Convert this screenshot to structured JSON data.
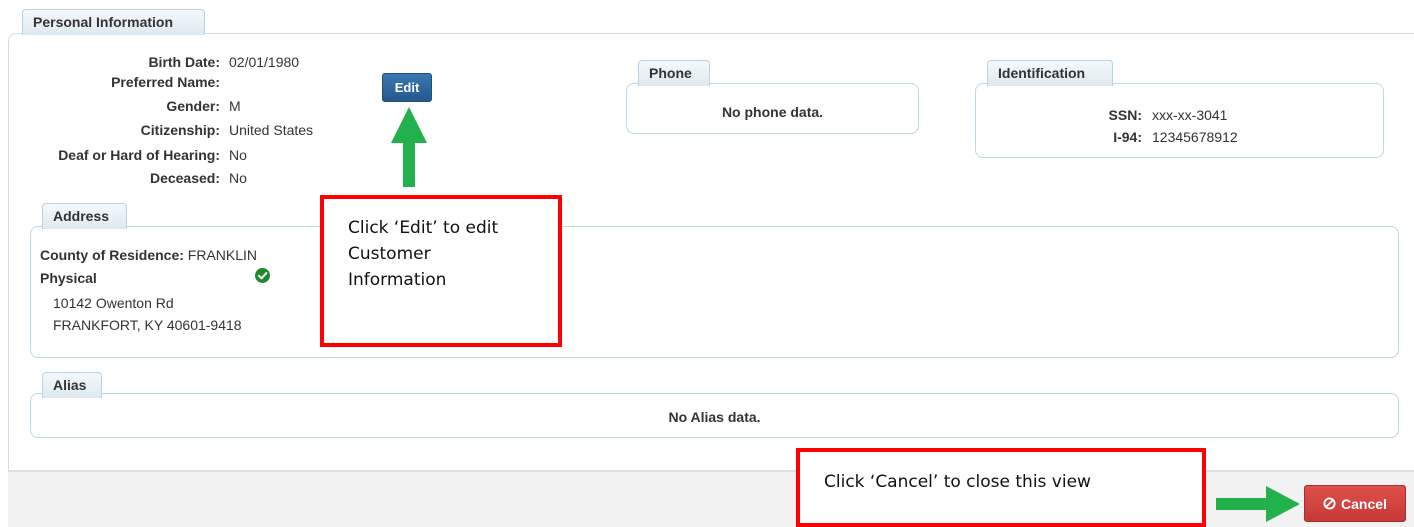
{
  "personal": {
    "tab_label": "Personal Information",
    "fields": [
      {
        "label": "Birth Date:",
        "value": "02/01/1980"
      },
      {
        "label": "Preferred Name:",
        "value": ""
      },
      {
        "label": "Gender:",
        "value": "M"
      },
      {
        "label": "Citizenship:",
        "value": "United States"
      },
      {
        "label": "Deaf or Hard of Hearing:",
        "value": "No"
      },
      {
        "label": "Deceased:",
        "value": "No"
      }
    ],
    "edit_label": "Edit"
  },
  "phone": {
    "tab_label": "Phone",
    "empty_text": "No phone data."
  },
  "identification": {
    "tab_label": "Identification",
    "fields": [
      {
        "label": "SSN:",
        "value": "xxx-xx-3041"
      },
      {
        "label": "I-94:",
        "value": "12345678912"
      }
    ]
  },
  "address": {
    "tab_label": "Address",
    "county_label": "County of Residence:",
    "county_value": "FRANKLIN",
    "type_label": "Physical",
    "line1": "10142 Owenton Rd",
    "line2": "FRANKFORT, KY 40601-9418",
    "verified_icon": "check-circle-icon"
  },
  "alias": {
    "tab_label": "Alias",
    "empty_text": "No Alias data."
  },
  "footer": {
    "cancel_label": "Cancel",
    "cancel_icon": "ban-icon"
  },
  "callouts": {
    "edit": {
      "line1": "Click ‘Edit’ to edit",
      "line2": "Customer",
      "line3": "Information"
    },
    "cancel": "Click ‘Cancel’ to close this view"
  },
  "colors": {
    "accent": "#2a6496",
    "danger": "#d9534f",
    "arrow": "#22b14c",
    "callout_border": "#ff0000",
    "verified": "#1e8a2e"
  }
}
